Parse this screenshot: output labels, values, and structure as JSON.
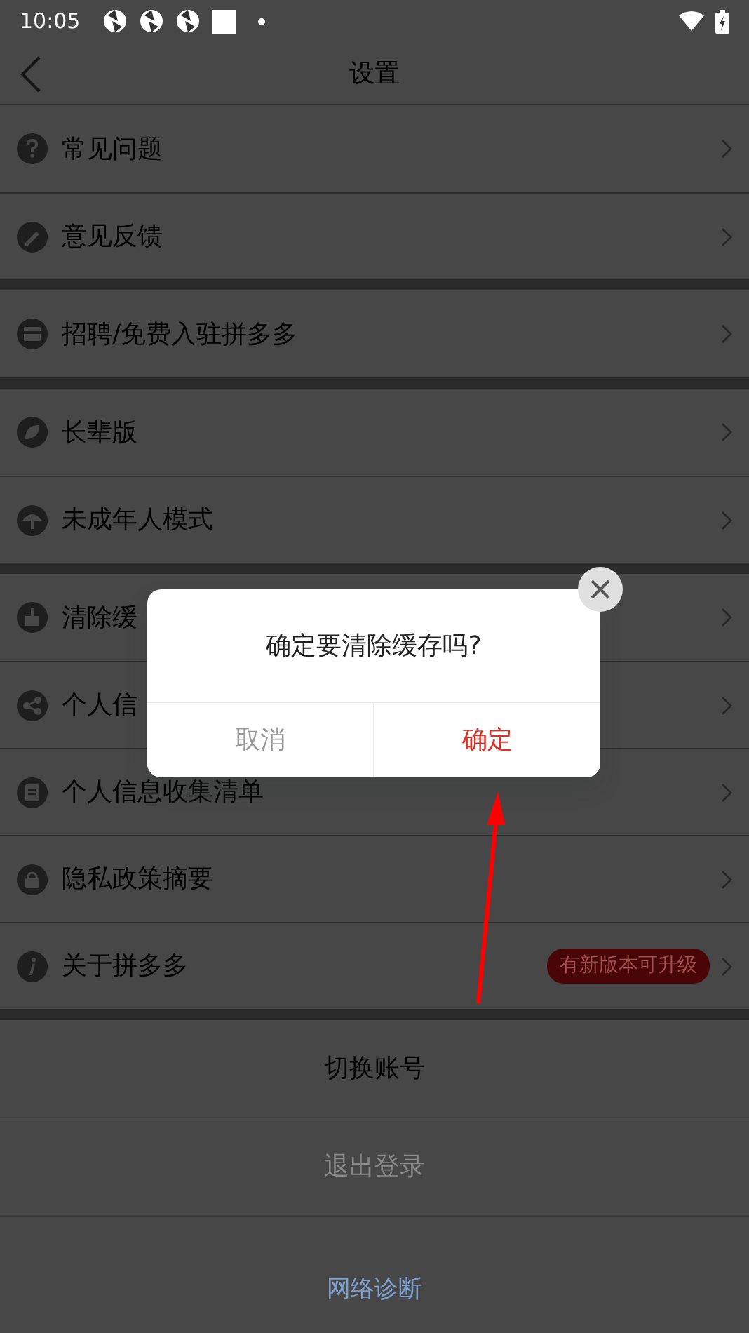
{
  "status_bar": {
    "time": "10:05"
  },
  "header": {
    "title": "设置"
  },
  "sections": [
    {
      "items": [
        {
          "label": "常见问题"
        },
        {
          "label": "意见反馈"
        }
      ]
    },
    {
      "items": [
        {
          "label": "招聘/免费入驻拼多多"
        }
      ]
    },
    {
      "items": [
        {
          "label": "长辈版"
        },
        {
          "label": "未成年人模式"
        }
      ]
    },
    {
      "items": [
        {
          "label": "清除缓"
        },
        {
          "label": "个人信"
        },
        {
          "label": "个人信息收集清单"
        },
        {
          "label": "隐私政策摘要"
        },
        {
          "label": "关于拼多多",
          "badge": "有新版本可升级"
        }
      ]
    }
  ],
  "actions": [
    {
      "kind": "primary",
      "label": "切换账号"
    },
    {
      "kind": "muted",
      "label": "退出登录"
    }
  ],
  "footer_link": "网络诊断",
  "dialog": {
    "message": "确定要清除缓存吗?",
    "buttons": [
      {
        "kind": "cancel",
        "label": "取消"
      },
      {
        "kind": "confirm",
        "label": "确定"
      }
    ]
  }
}
